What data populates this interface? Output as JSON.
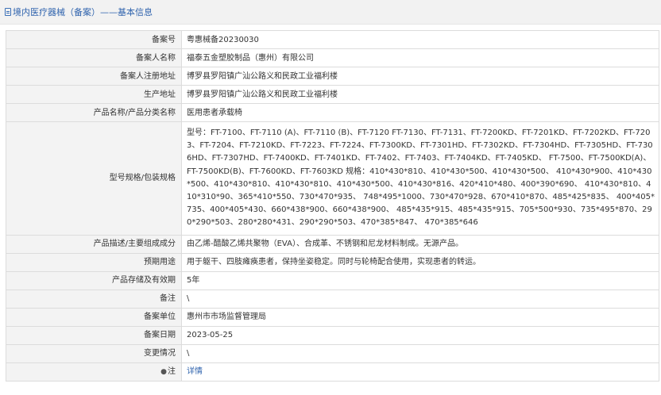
{
  "header": {
    "title": "境内医疗器械（备案）——基本信息"
  },
  "rows": [
    {
      "label": "备案号",
      "value": "粤惠械备20230030"
    },
    {
      "label": "备案人名称",
      "value": "福泰五金塑胶制品（惠州）有限公司"
    },
    {
      "label": "备案人注册地址",
      "value": "博罗县罗阳镇广汕公路义和民政工业福利楼"
    },
    {
      "label": "生产地址",
      "value": "博罗县罗阳镇广汕公路义和民政工业福利楼"
    },
    {
      "label": "产品名称/产品分类名称",
      "value": "医用患者承载椅"
    },
    {
      "label": "型号规格/包装规格",
      "value": "型号：FT-7100、FT-7110 (A)、FT-7110 (B)、FT-7120 FT-7130、FT-7131、FT-7200KD、FT-7201KD、FT-7202KD、FT-7203、FT-7204、FT-7210KD、FT-7223、FT-7224、FT-7300KD、FT-7301HD、FT-7302KD、FT-7304HD、FT-7305HD、FT-7306HD、FT-7307HD、FT-7400KD、FT-7401KD、FT-7402、FT-7403、FT-7404KD、FT-7405KD、 FT-7500、FT-7500KD(A)、FT-7500KD(B)、FT-7600KD、FT-7603KD 规格：410*430*810、410*430*500、410*430*500、 410*430*900、410*430*500、410*430*810、410*430*810、410*430*500、410*430*816、420*410*480、400*390*690、 410*430*810、410*310*90、365*410*550、730*470*935、 748*495*1000、730*470*928、670*410*870、485*425*835、 400*405*735、400*405*430、660*438*900、660*438*900、 485*435*915、485*435*915、705*500*930、735*495*870、290*290*503、280*280*431、290*290*503、470*385*847、 470*385*646"
    },
    {
      "label": "产品描述/主要组成成分",
      "value": "由乙烯-醋酸乙烯共聚物（EVA）、合成革、不锈钢和尼龙材料制成。无源产品。"
    },
    {
      "label": "预期用途",
      "value": "用于躯干、四肢瘫痪患者，保持坐姿稳定。同时与轮椅配合使用，实现患者的转运。"
    },
    {
      "label": "产品存储及有效期",
      "value": "5年"
    },
    {
      "label": "备注",
      "value": "\\"
    },
    {
      "label": "备案单位",
      "value": "惠州市市场监督管理局"
    },
    {
      "label": "备案日期",
      "value": "2023-05-25"
    },
    {
      "label": "变更情况",
      "value": "\\"
    },
    {
      "label": "注",
      "pin_icon": "location-pin",
      "value": "详情"
    }
  ]
}
